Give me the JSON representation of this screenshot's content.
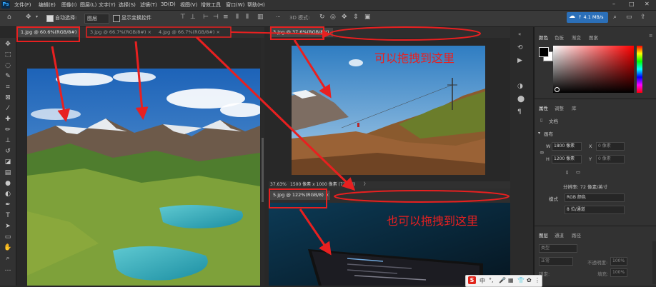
{
  "menu": {
    "logo": "Ps",
    "items": [
      "文件(F)",
      "编辑(E)",
      "图像(I)",
      "图层(L)",
      "文字(Y)",
      "选择(S)",
      "滤镜(T)",
      "3D(D)",
      "视图(V)",
      "增效工具",
      "窗口(W)",
      "帮助(H)"
    ]
  },
  "window_controls": {
    "minimize": "–",
    "maximize": "□",
    "close": "✕"
  },
  "cloud": {
    "speed": "↑ 4.1 MB/s"
  },
  "options": {
    "auto_select_label": "自动选择:",
    "auto_select_value": "图层",
    "show_transform_label": "显示变换控件",
    "mode_3d_label": "3D 模式:",
    "more": "···"
  },
  "tabs": {
    "left": [
      {
        "label": "1.jpg @ 60.6%(RGB/8#)",
        "close": "×"
      },
      {
        "label": "3.jpg @ 66.7%(RGB/8#)",
        "close": "×"
      },
      {
        "label": "4.jpg @ 66.7%(RGB/8#)",
        "close": "×"
      }
    ],
    "right_top": {
      "label": "3.jpg @ 37.6%(RGB/8#)",
      "close": "×"
    },
    "right_bottom": {
      "label": "5.jpg @ 122%(RGB/8)",
      "close": "×"
    }
  },
  "status": {
    "zoom": "37.63%",
    "dims": "1500 像素 x 1000 像素 (72 ppi)",
    "arrow": "〉"
  },
  "annotations": {
    "top": "可以拖拽到这里",
    "bottom": "也可以拖拽到这里"
  },
  "color_panel": {
    "tabs": [
      "颜色",
      "色板",
      "渐变",
      "图案"
    ]
  },
  "properties_panel": {
    "tabs": [
      "属性",
      "调整",
      "库"
    ],
    "doc_label": "文档",
    "canvas_label": "画布",
    "w_label": "W",
    "w_value": "1800 像素",
    "h_label": "H",
    "h_value": "1200 像素",
    "x_label": "X",
    "x_value": "0 像素",
    "y_label": "Y",
    "y_value": "0 像素",
    "resolution": "分辨率: 72 像素/英寸",
    "mode_label": "模式",
    "mode_value": "RGB 颜色",
    "depth_value": "8 位/通道"
  },
  "layers_panel": {
    "tabs": [
      "图层",
      "通道",
      "路径"
    ],
    "search_placeholder": "类型",
    "blend": "正常",
    "opacity_label": "不透明度:",
    "opacity_value": "100%",
    "lock_label": "锁定:",
    "fill_label": "填充:",
    "fill_value": "100%"
  },
  "ime": {
    "brand": "S",
    "items": [
      "中",
      "°,",
      "🎤",
      "▦",
      "👕",
      "✿",
      "⋮⋮"
    ]
  },
  "colors": {
    "accent": "#31a8ff",
    "annotation": "#e82020",
    "fg_swatch": "#000000",
    "bg_swatch": "#ffffff"
  }
}
